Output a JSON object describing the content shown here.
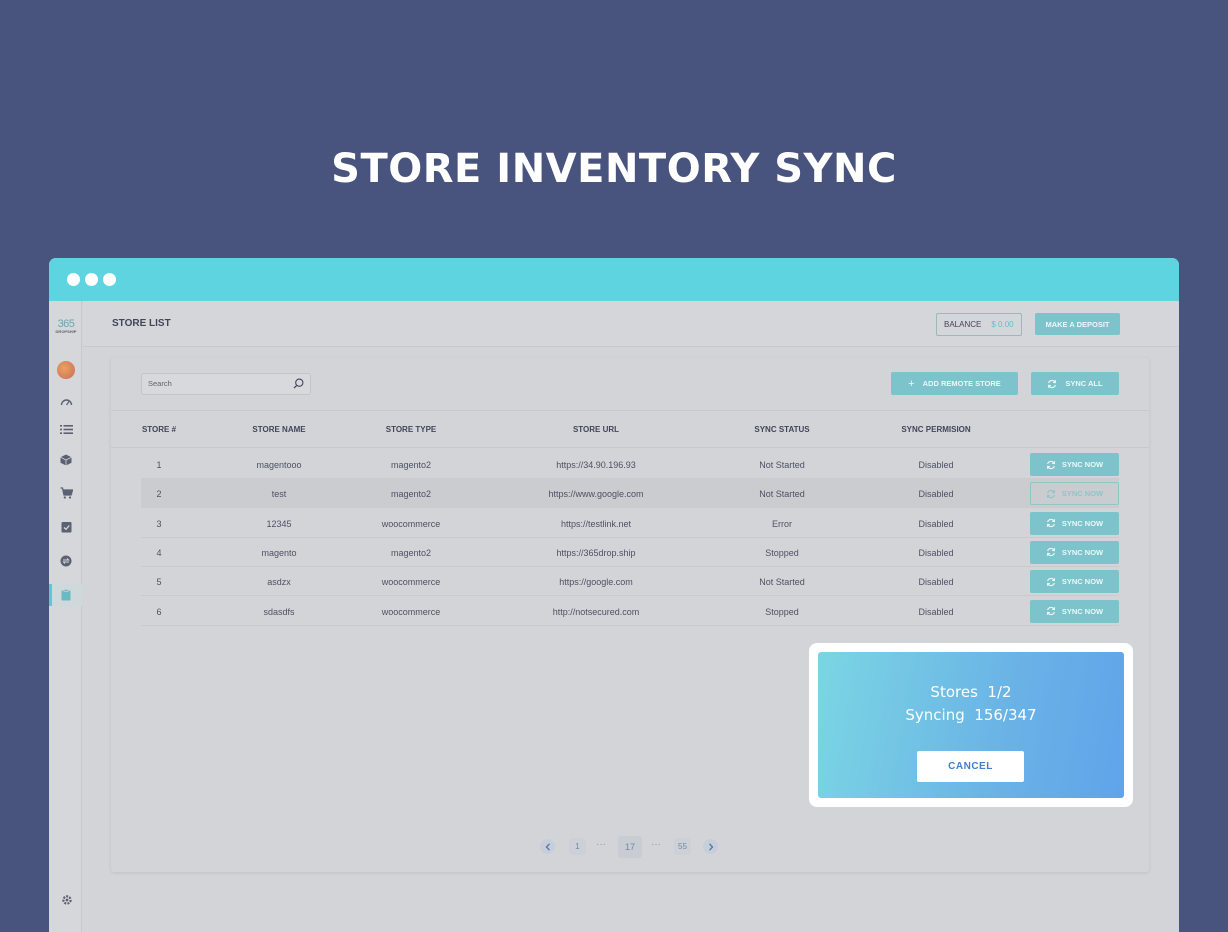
{
  "hero": {
    "title": "STORE INVENTORY SYNC"
  },
  "logo": {
    "number": "365",
    "sub": "DROPSHIP"
  },
  "topbar": {
    "title": "STORE LIST",
    "balance_label": "BALANCE",
    "balance_value": "$ 0.00",
    "deposit_label": "MAKE A DEPOSIT"
  },
  "toolbar": {
    "search_placeholder": "Search",
    "add_label": "ADD REMOTE STORE",
    "sync_all_label": "SYNC ALL"
  },
  "table": {
    "headers": [
      "STORE #",
      "STORE NAME",
      "STORE TYPE",
      "STORE URL",
      "SYNC STATUS",
      "SYNC PERMISION"
    ],
    "rows": [
      {
        "num": "1",
        "name": "magentooo",
        "type": "magento2",
        "url": "https://34.90.196.93",
        "status": "Not Started",
        "permission": "Disabled",
        "action": "SYNC NOW"
      },
      {
        "num": "2",
        "name": "test",
        "type": "magento2",
        "url": "https://www.google.com",
        "status": "Not Started",
        "permission": "Disabled",
        "action": "SYNC NOW"
      },
      {
        "num": "3",
        "name": "12345",
        "type": "woocommerce",
        "url": "https://testlink.net",
        "status": "Error",
        "permission": "Disabled",
        "action": "SYNC NOW"
      },
      {
        "num": "4",
        "name": "magento",
        "type": "magento2",
        "url": "https://365drop.ship",
        "status": "Stopped",
        "permission": "Disabled",
        "action": "SYNC NOW"
      },
      {
        "num": "5",
        "name": "asdzx",
        "type": "woocommerce",
        "url": "https://google.com",
        "status": "Not Started",
        "permission": "Disabled",
        "action": "SYNC NOW"
      },
      {
        "num": "6",
        "name": "sdasdfs",
        "type": "woocommerce",
        "url": "http://notsecured.com",
        "status": "Stopped",
        "permission": "Disabled",
        "action": "SYNC NOW"
      }
    ]
  },
  "pagination": {
    "first": "1",
    "dots": "···",
    "current": "17",
    "last": "55"
  },
  "modal": {
    "stores_line": "Stores  1/2",
    "syncing_line": "Syncing  156/347",
    "cancel_label": "CANCEL"
  },
  "colors": {
    "background": "#48537e",
    "window_bar": "#5dd4e0",
    "accent_teal": "#7cc3cb",
    "modal_gradient_start": "#7bd6e3",
    "modal_gradient_end": "#60a4ea"
  },
  "icons": {
    "sidebar": [
      "avatar",
      "speedometer-icon",
      "list-icon",
      "box-icon",
      "cart-icon",
      "checklist-icon",
      "swap-icon",
      "clipboard-icon",
      "gear-icon"
    ],
    "buttons": [
      "plus-icon",
      "sync-icon"
    ]
  }
}
